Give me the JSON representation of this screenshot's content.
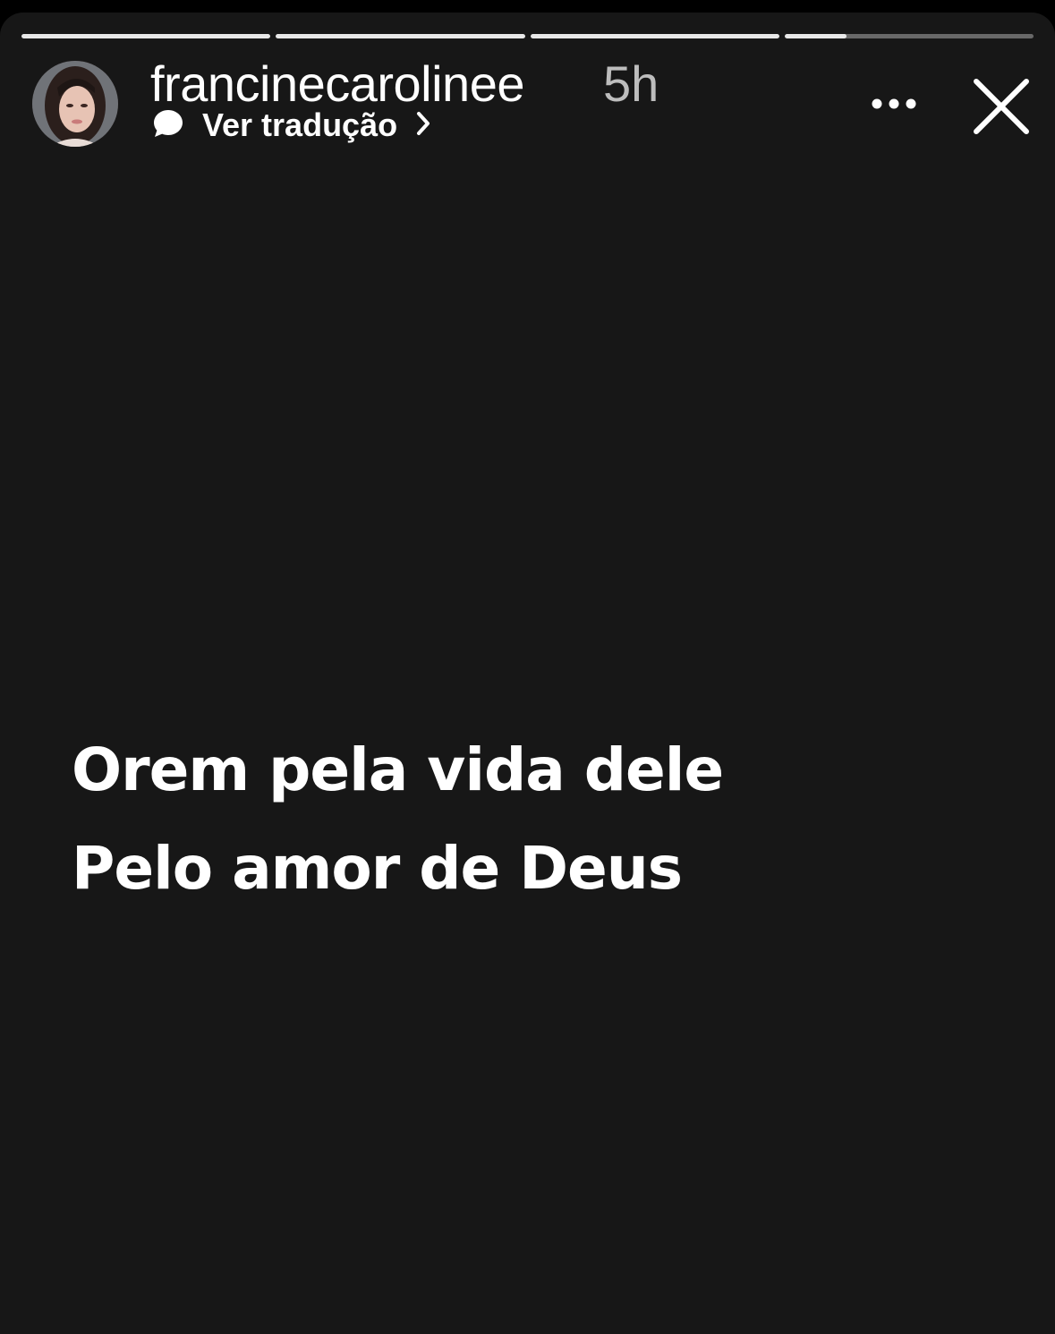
{
  "story": {
    "progress": [
      1,
      1,
      1,
      0.25
    ],
    "username": "francinecarolinee",
    "timestamp": "5h",
    "translate_label": "Ver tradução",
    "text_lines": [
      "Orem pela vida dele",
      "Pelo amor de Deus"
    ]
  },
  "icons": {
    "translate": "speech-bubble-icon",
    "chevron": "chevron-right-icon",
    "more": "more-dots-icon",
    "close": "close-icon"
  },
  "colors": {
    "background": "#171717",
    "text": "#ffffff",
    "timestamp": "#bdbdbd"
  }
}
